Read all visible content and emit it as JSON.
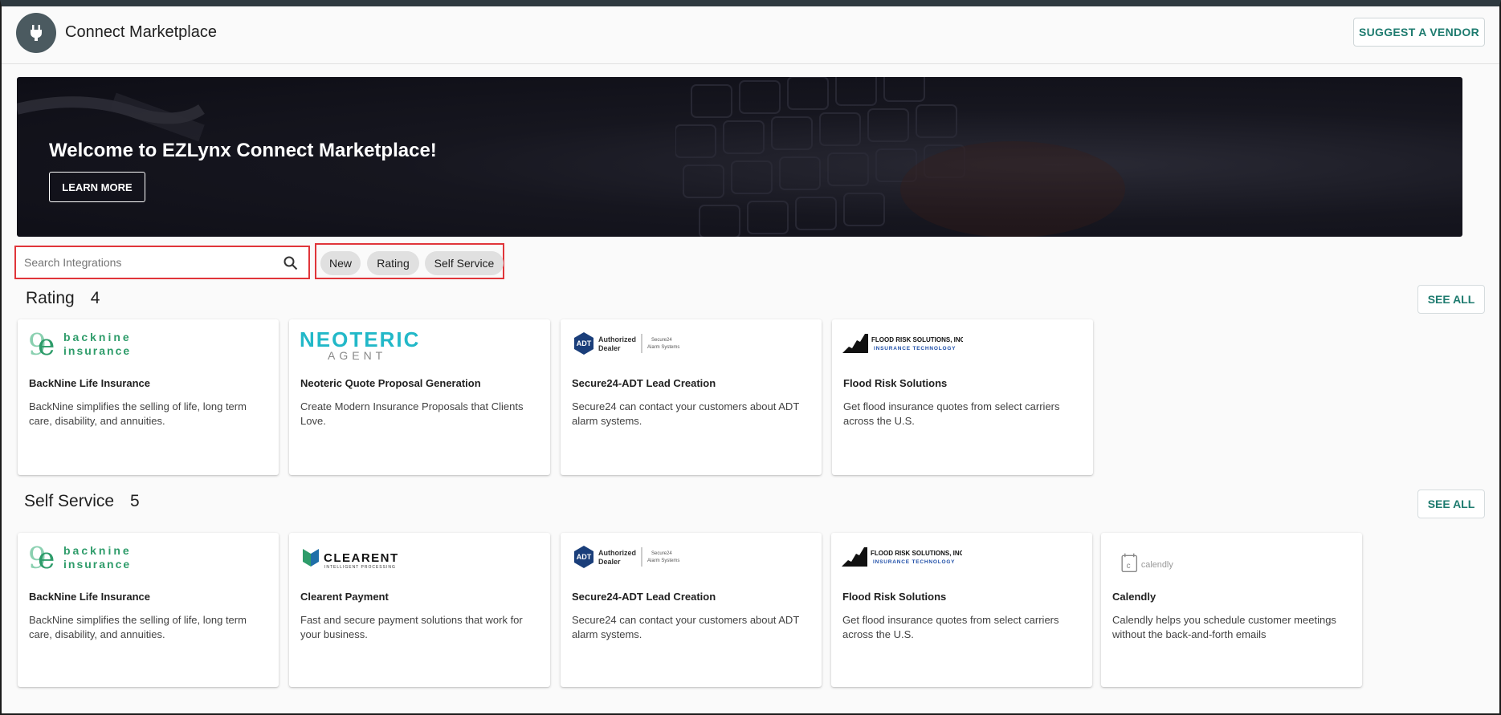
{
  "header": {
    "title": "Connect Marketplace",
    "suggest_label": "SUGGEST A VENDOR",
    "app_icon": "plug-icon"
  },
  "banner": {
    "title": "Welcome to EZLynx Connect Marketplace!",
    "learn_more": "LEARN MORE"
  },
  "search": {
    "placeholder": "Search Integrations",
    "value": ""
  },
  "filters": [
    "New",
    "Rating",
    "Self Service"
  ],
  "sections": [
    {
      "title": "Rating",
      "count": "4",
      "see_all": "SEE ALL",
      "cards": [
        {
          "logo": "backnine-logo",
          "title": "BackNine Life Insurance",
          "desc": "BackNine simplifies the selling of life, long term care, disability, and annuities."
        },
        {
          "logo": "neoteric-logo",
          "title": "Neoteric Quote Proposal Generation",
          "desc": "Create Modern Insurance Proposals that Clients Love."
        },
        {
          "logo": "adt-logo",
          "title": "Secure24-ADT Lead Creation",
          "desc": "Secure24 can contact your customers about ADT alarm systems."
        },
        {
          "logo": "flood-logo",
          "title": "Flood Risk Solutions",
          "desc": "Get flood insurance quotes from select carriers across the U.S."
        }
      ]
    },
    {
      "title": "Self Service",
      "count": "5",
      "see_all": "SEE ALL",
      "cards": [
        {
          "logo": "backnine-logo",
          "title": "BackNine Life Insurance",
          "desc": "BackNine simplifies the selling of life, long term care, disability, and annuities."
        },
        {
          "logo": "clearent-logo",
          "title": "Clearent Payment",
          "desc": "Fast and secure payment solutions that work for your business."
        },
        {
          "logo": "adt-logo",
          "title": "Secure24-ADT Lead Creation",
          "desc": "Secure24 can contact your customers about ADT alarm systems."
        },
        {
          "logo": "flood-logo",
          "title": "Flood Risk Solutions",
          "desc": "Get flood insurance quotes from select carriers across the U.S."
        },
        {
          "logo": "calendly-logo",
          "title": "Calendly",
          "desc": "Calendly helps you schedule customer meetings without the back-and-forth emails"
        }
      ]
    }
  ],
  "logos": {
    "backnine": {
      "line1": "backnine",
      "line2": "insurance"
    },
    "neoteric": {
      "line1": "NEOTERIC",
      "line2": "AGENT"
    },
    "adt": {
      "mark": "ADT",
      "line1": "Authorized",
      "line2": "Dealer",
      "side1": "Secure24",
      "side2": "Alarm Systems"
    },
    "flood": {
      "line1": "FLOOD RISK SOLUTIONS, INC.",
      "line2": "INSURANCE TECHNOLOGY"
    },
    "clearent": {
      "line1": "CLEARENT",
      "line2": "INTELLIGENT PROCESSING"
    },
    "calendly": {
      "line1": "calendly"
    }
  },
  "colors": {
    "accent": "#1e7b6f",
    "highlight_border": "#e0353a",
    "backnine_green": "#2e9c6a",
    "neoteric_cyan": "#22b8c8",
    "adt_blue": "#1a3e7a",
    "flood_blue": "#1f4fa8"
  }
}
